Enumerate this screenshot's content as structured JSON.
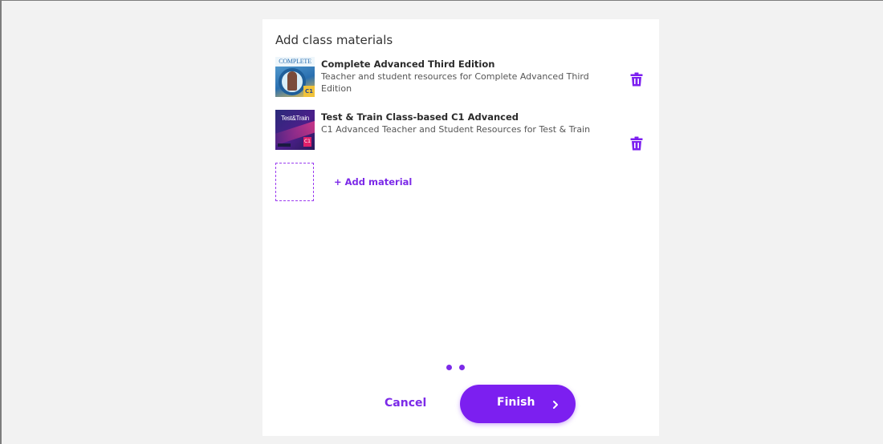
{
  "dialog": {
    "title": "Add class materials"
  },
  "materials": [
    {
      "cover_text": "COMPLETE",
      "cover_badge": "C1",
      "title": "Complete Advanced Third Edition",
      "description": "Teacher and student resources for Complete Advanced Third Edition"
    },
    {
      "cover_text": "Test&Train",
      "cover_badge": "C1",
      "title": "Test & Train Class-based C1 Advanced",
      "description": "C1 Advanced Teacher and Student Resources for Test & Train"
    }
  ],
  "add_material": {
    "label": "+ Add material"
  },
  "pagination": {
    "total_dots": 2
  },
  "actions": {
    "cancel_label": "Cancel",
    "finish_label": "Finish"
  },
  "colors": {
    "accent": "#7c1ff0",
    "link": "#7c2ae8",
    "background": "#f2f2f2",
    "card": "#ffffff"
  },
  "icons": {
    "delete": "trash-icon",
    "next": "chevron-right-icon"
  }
}
